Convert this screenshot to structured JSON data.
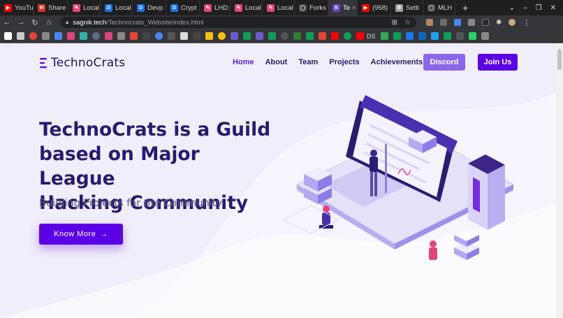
{
  "browser": {
    "tabs": [
      {
        "label": "YouTu",
        "icon": "youtube-icon",
        "color": "#ff0000",
        "glyph": "▶"
      },
      {
        "label": "Share",
        "icon": "gmail-icon",
        "color": "#d93025",
        "glyph": "M"
      },
      {
        "label": "Local",
        "icon": "local-icon",
        "color": "#e0457b",
        "glyph": "✎"
      },
      {
        "label": "Local",
        "icon": "d-icon",
        "color": "#1a73e8",
        "glyph": "D"
      },
      {
        "label": "Devp",
        "icon": "d-icon",
        "color": "#1a73e8",
        "glyph": "D"
      },
      {
        "label": "Crypt",
        "icon": "d-icon",
        "color": "#1a73e8",
        "glyph": "D"
      },
      {
        "label": "LHD:",
        "icon": "local-icon",
        "color": "#e0457b",
        "glyph": "✎"
      },
      {
        "label": "Local",
        "icon": "local-icon",
        "color": "#e0457b",
        "glyph": "✎"
      },
      {
        "label": "Local",
        "icon": "local-icon",
        "color": "#e0457b",
        "glyph": "✎"
      },
      {
        "label": "Forks",
        "icon": "github-icon",
        "color": "#444444",
        "glyph": "◯"
      },
      {
        "label": "Te",
        "icon": "b-icon",
        "color": "#6f42c1",
        "glyph": "B",
        "active": true
      },
      {
        "label": "(958)",
        "icon": "youtube-icon",
        "color": "#ff0000",
        "glyph": "▶"
      },
      {
        "label": "Setti",
        "icon": "gear-icon",
        "color": "#9aa0a6",
        "glyph": "⚙"
      },
      {
        "label": "MLH",
        "icon": "github-icon",
        "color": "#444444",
        "glyph": "◯"
      }
    ],
    "url_host": "sagnik.tech",
    "url_path": "/Technocrats_Website/index.html",
    "bookmark_label": "DS"
  },
  "site": {
    "brand": "TechnoCrats",
    "nav": [
      {
        "label": "Home",
        "active": true
      },
      {
        "label": "About"
      },
      {
        "label": "Team"
      },
      {
        "label": "Projects"
      },
      {
        "label": "Achievements"
      }
    ],
    "discord_label": "Discord",
    "join_label": "Join Us",
    "hero_title_1": "TechnoCrats is a Guild",
    "hero_title_2": "based on Major League",
    "hero_title_3": "Hacking Community",
    "hero_subtitle": "Building Projects for the Community",
    "cta_label": "Know More",
    "cta_arrow": "→"
  },
  "colors": {
    "primary": "#5b00e6",
    "discord": "#8a67e8",
    "heading": "#2a1a6e",
    "page_bg": "#f6f5fd"
  }
}
